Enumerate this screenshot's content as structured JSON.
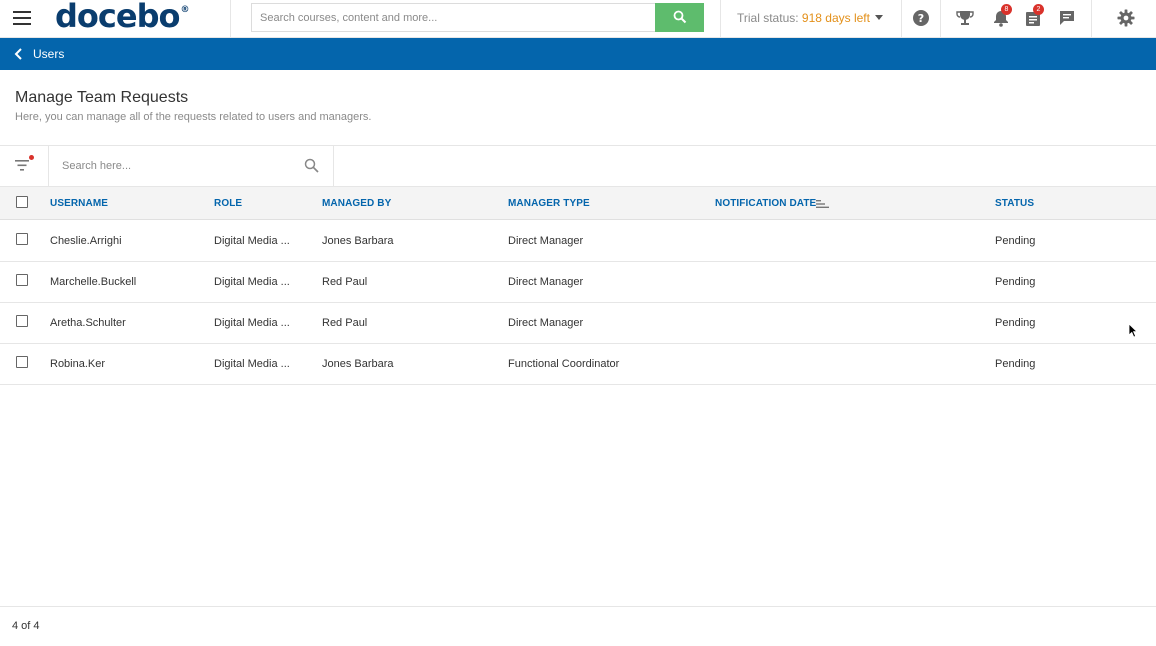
{
  "topbar": {
    "logo": "docebo",
    "logo_mark": "®",
    "search_placeholder": "Search courses, content and more...",
    "trial_label": "Trial status:",
    "trial_days": "918 days left",
    "notifications_count": "8",
    "tasks_count": "2"
  },
  "breadcrumb": {
    "back_label": "Users"
  },
  "page": {
    "title": "Manage Team Requests",
    "subtitle": "Here, you can manage all of the requests related to users and managers."
  },
  "filter": {
    "search_placeholder": "Search here..."
  },
  "table": {
    "columns": [
      "USERNAME",
      "ROLE",
      "MANAGED BY",
      "MANAGER TYPE",
      "NOTIFICATION DATE",
      "STATUS"
    ],
    "rows": [
      {
        "username": "Cheslie.Arrighi",
        "role": "Digital Media ...",
        "managed_by": "Jones Barbara",
        "manager_type": "Direct Manager",
        "notification_date": "",
        "status": "Pending"
      },
      {
        "username": "Marchelle.Buckell",
        "role": "Digital Media ...",
        "managed_by": "Red Paul",
        "manager_type": "Direct Manager",
        "notification_date": "",
        "status": "Pending"
      },
      {
        "username": "Aretha.Schulter",
        "role": "Digital Media ...",
        "managed_by": "Red Paul",
        "manager_type": "Direct Manager",
        "notification_date": "",
        "status": "Pending"
      },
      {
        "username": "Robina.Ker",
        "role": "Digital Media ...",
        "managed_by": "Jones Barbara",
        "manager_type": "Functional Coordinator",
        "notification_date": "",
        "status": "Pending"
      }
    ]
  },
  "footer": {
    "count": "4 of 4"
  },
  "colors": {
    "brand_blue": "#0465ac",
    "logo_blue": "#0a3d6e",
    "search_green": "#5ebc6d",
    "trial_orange": "#e3901a",
    "badge_red": "#d9322b"
  },
  "icons": [
    "menu-icon",
    "search-icon",
    "help-icon",
    "trophy-icon",
    "bell-icon",
    "tasks-icon",
    "chat-icon",
    "gear-icon",
    "chevron-left-icon",
    "filter-icon",
    "sort-icon"
  ]
}
